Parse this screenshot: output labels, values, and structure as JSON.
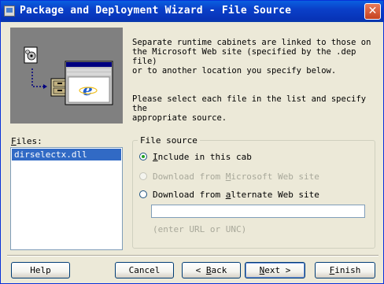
{
  "window": {
    "title": "Package and Deployment Wizard - File Source",
    "close_glyph": "✕"
  },
  "info": {
    "paragraph1": "Separate runtime cabinets are linked to those on\nthe Microsoft Web site (specified by the .dep file)\nor to another location you specify below.",
    "paragraph2": "Please select each file in the list and specify the\nappropriate source."
  },
  "files": {
    "label_accel": "F",
    "label_rest": "iles:",
    "items": [
      "dirselectx.dll"
    ],
    "selected_index": 0
  },
  "file_source": {
    "group_label": "File source",
    "options": [
      {
        "pre": "",
        "accel": "I",
        "post": "nclude in this cab",
        "checked": true,
        "enabled": true
      },
      {
        "pre": "Download from ",
        "accel": "M",
        "post": "icrosoft Web site",
        "checked": false,
        "enabled": false
      },
      {
        "pre": "Download from ",
        "accel": "a",
        "post": "lternate Web site",
        "checked": false,
        "enabled": true
      }
    ],
    "url_value": "",
    "url_hint": "(enter URL or UNC)"
  },
  "buttons": {
    "help": "Help",
    "cancel": "Cancel",
    "back_prefix": "< ",
    "back_accel": "B",
    "back_rest": "ack",
    "next_accel": "N",
    "next_rest": "ext >",
    "finish_accel": "F",
    "finish_rest": "inish"
  },
  "colors": {
    "titlebar": "#0a3fc8",
    "selection": "#316ac5",
    "dialog_bg": "#ece9d8"
  }
}
